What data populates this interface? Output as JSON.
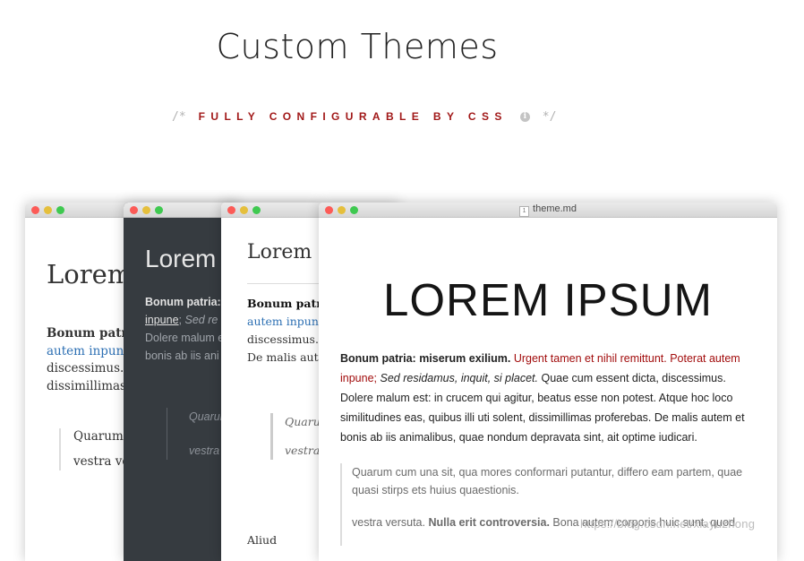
{
  "header": {
    "title": "Custom Themes",
    "comment_open": "/*",
    "subtitle": "FULLY CONFIGURABLE BY CSS",
    "comment_close": "*/",
    "info_icon": "i"
  },
  "windows": {
    "w1": {
      "heading": "Lorem",
      "para_bold": "Bonum patria",
      "para_link": "autem inpune",
      "para_rest": "discessimus. I potest. Atque dissimillimas nondum depr",
      "quote1": "Quarum partem, d",
      "quote2": "vestra ve sunt, quo requiras?"
    },
    "w2": {
      "heading": "Lorem",
      "para_bold": "Bonum patria:",
      "para_link": "inpune",
      "para_sep": ";",
      "para_italic": "Sed re",
      "para_rest": "Dolere malum e similitudines e bonis ab iis ani",
      "quote1": "Quarum quae q",
      "quote2": "vestra quod p Haec e"
    },
    "w3": {
      "heading": "Lorem i",
      "para_bold": "Bonum patria",
      "para_link": "autem inpune",
      "para_rest": "discessimus. D Atque hoc loc De malis auter optime iudicar",
      "quote1": "Quarun quae qu",
      "quote2": "vestra quod po et tu i",
      "tail": "Aliud"
    },
    "w4": {
      "file_icon": "1",
      "file_name": "theme.md",
      "heading": "LOREM IPSUM",
      "para_bold": "Bonum patria: miserum exilium.",
      "para_red": "Urgent tamen et nihil remittunt. Poterat autem inpune;",
      "para_italic": "Sed residamus, inquit, si placet.",
      "para_rest": "Quae cum essent dicta, discessimus. Dolere malum est: in crucem qui agitur, beatus esse non potest. Atque hoc loco similitudines eas, quibus illi uti solent, dissimillimas proferebas. De malis autem et bonis ab iis animalibus, quae nondum depravata sint, ait optime iudicari.",
      "quote1": "Quarum cum una sit, qua mores conformari putantur, differo eam partem, quae quasi stirps ets huius quaestionis.",
      "quote2_start": "vestra versuta.",
      "quote2_bold": "Nulla erit controversia.",
      "quote2_rest": "Bona autem corporis huic sunt, quod"
    }
  },
  "watermark": "https://blog.csdn.net/xiayuzhong"
}
